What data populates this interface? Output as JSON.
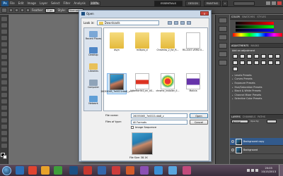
{
  "photoshop": {
    "logo": "Ps",
    "menus": [
      "File",
      "Edit",
      "Image",
      "Layer",
      "Select",
      "Filter",
      "Analysis"
    ],
    "zoom": "100%",
    "workspaces": [
      "ESSENTIALS",
      "DESIGN",
      "PAINTING"
    ],
    "options": {
      "feather_label": "Feather:",
      "feather_value": "0 px",
      "style_label": "Style:",
      "style_value": "Normal"
    }
  },
  "dialog": {
    "title": "Open",
    "close_label": "x",
    "look_in_label": "Look in:",
    "look_in_value": "Downloads",
    "places": [
      {
        "label": "Recent Places",
        "color": "#7aa7d6"
      },
      {
        "label": "Desktop",
        "color": "#4f86c6"
      },
      {
        "label": "Libraries",
        "color": "#e8c15a"
      },
      {
        "label": "Computer",
        "color": "#8fa3b8"
      },
      {
        "label": "Network",
        "color": "#5f9ed6"
      }
    ],
    "files": [
      {
        "name": "dsyn",
        "kind": "folder"
      },
      {
        "name": "milkpro_cl",
        "kind": "folder"
      },
      {
        "name": "Chromiss_2_for_R...",
        "kind": "folder"
      },
      {
        "name": "RS-2007-VERSI 0...",
        "kind": "doc"
      },
      {
        "name": "26055065_7e0021cbb8_z-...",
        "kind": "photo"
      },
      {
        "name": "AdbeRdr940_en_US...",
        "kind": "doc"
      },
      {
        "name": "chrome_installer_E...",
        "kind": "doc"
      },
      {
        "name": "Malicia",
        "kind": "doc"
      }
    ],
    "file_name_label": "File name:",
    "file_name_value": "26055065_7e0021cbb8_z",
    "files_type_label": "Files of type:",
    "files_type_value": "All Formats",
    "open_label": "Open",
    "cancel_label": "Cancel",
    "image_sequence_label": "Image Sequence",
    "file_size": "File Size: 38.1K"
  },
  "panels": {
    "color_tabs": [
      "COLOR",
      "SWATCHES",
      "STYLES"
    ],
    "adjustments_tabs": [
      "ADJUSTMENTS",
      "MASKS"
    ],
    "adjustments_title": "Add an adjustment",
    "presets": [
      "Levels Presets",
      "Curves Presets",
      "Exposure Presets",
      "Hue/Saturation Presets",
      "Black & White Presets",
      "Channel Mixer Presets",
      "Selective Color Presets"
    ],
    "layers_tabs": [
      "LAYERS",
      "CHANNELS",
      "PATHS"
    ],
    "blend_mode": "Normal",
    "opacity_label": "Opacity:",
    "layers": [
      "Background copy",
      "Background"
    ]
  },
  "taskbar": {
    "time": "20:03",
    "date": "10/15/2013"
  }
}
